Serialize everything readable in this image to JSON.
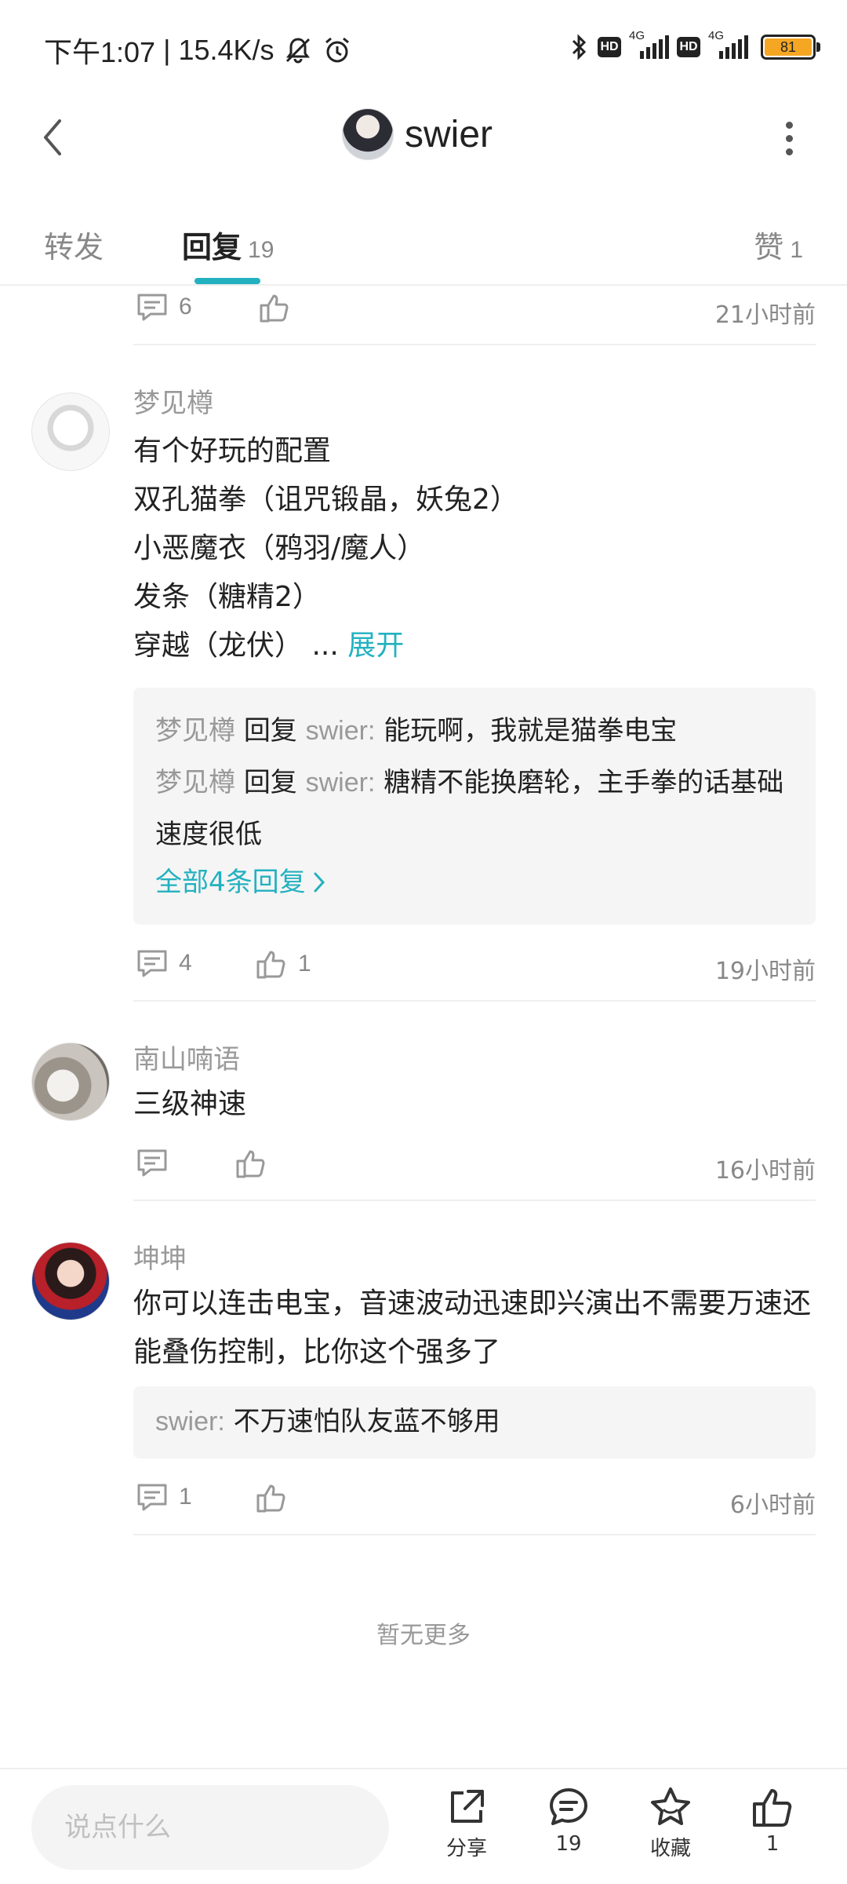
{
  "status_bar": {
    "time": "下午1:07",
    "separator": "|",
    "net_speed": "15.4K/s",
    "hd1": "HD",
    "net1": "4G",
    "hd2": "HD",
    "net2": "4G",
    "battery": "81"
  },
  "header": {
    "username": "swier"
  },
  "tabs": {
    "forward": {
      "label": "转发"
    },
    "reply": {
      "label": "回复",
      "count": "19"
    },
    "like": {
      "label": "赞",
      "count": "1"
    }
  },
  "top_partial": {
    "reply_count": "6",
    "time": "21小时前"
  },
  "comments": [
    {
      "name": "梦见樽",
      "lines": [
        "有个好玩的配置",
        "双孔猫拳（诅咒锻晶，妖兔2）",
        "小恶魔衣（鸦羽/魔人）",
        "发条（糖精2）",
        "穿越（龙伏）"
      ],
      "ellipsis": "...",
      "expand": "展开",
      "replies": [
        {
          "from": "梦见樽",
          "verb": "回复",
          "to": "swier",
          "colon": ":",
          "text": "能玩啊，我就是猫拳电宝"
        },
        {
          "from": "梦见樽",
          "verb": "回复",
          "to": "swier",
          "colon": ":",
          "text": "糖精不能换磨轮，主手拳的话基础速度很低"
        }
      ],
      "all_replies": "全部4条回复",
      "reply_count": "4",
      "like_count": "1",
      "time": "19小时前"
    },
    {
      "name": "南山喃语",
      "text": "三级神速",
      "time": "16小时前"
    },
    {
      "name": "坤坤",
      "text": "你可以连击电宝，音速波动迅速即兴演出不需要万速还能叠伤控制，比你这个强多了",
      "reply": {
        "from": "swier",
        "colon": ":",
        "text": "不万速怕队友蓝不够用"
      },
      "reply_count": "1",
      "time": "6小时前"
    }
  ],
  "footer": {
    "no_more": "暂无更多"
  },
  "bottom_bar": {
    "placeholder": "说点什么",
    "share_label": "分享",
    "comment_count": "19",
    "collect_label": "收藏",
    "like_count": "1"
  },
  "colors": {
    "accent": "#23b1c0",
    "muted": "#999999",
    "text": "#222222"
  }
}
